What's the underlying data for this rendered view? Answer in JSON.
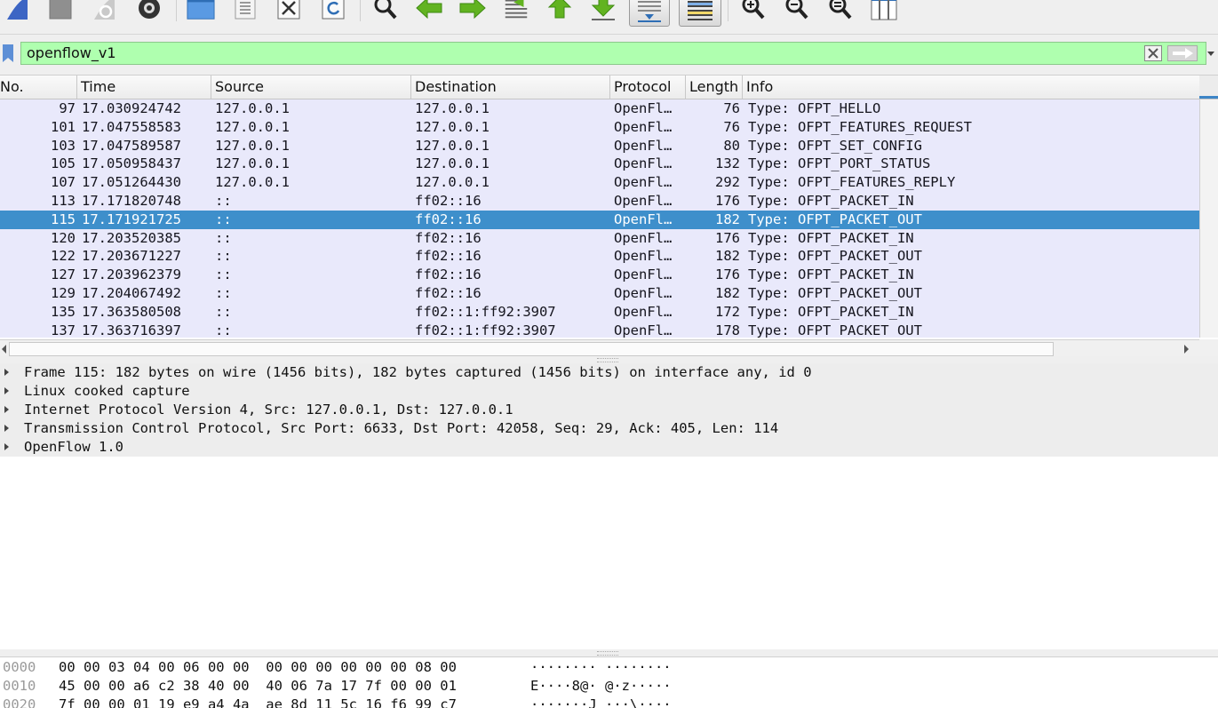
{
  "filter": {
    "value": "openflow_v1"
  },
  "packet_list": {
    "columns": [
      "No.",
      "Time",
      "Source",
      "Destination",
      "Protocol",
      "Length",
      "Info"
    ],
    "rows": [
      {
        "no": "97",
        "time": "17.030924742",
        "source": "127.0.0.1",
        "destination": "127.0.0.1",
        "protocol": "OpenFl…",
        "length": "76",
        "info": "Type: OFPT_HELLO"
      },
      {
        "no": "101",
        "time": "17.047558583",
        "source": "127.0.0.1",
        "destination": "127.0.0.1",
        "protocol": "OpenFl…",
        "length": "76",
        "info": "Type: OFPT_FEATURES_REQUEST"
      },
      {
        "no": "103",
        "time": "17.047589587",
        "source": "127.0.0.1",
        "destination": "127.0.0.1",
        "protocol": "OpenFl…",
        "length": "80",
        "info": "Type: OFPT_SET_CONFIG"
      },
      {
        "no": "105",
        "time": "17.050958437",
        "source": "127.0.0.1",
        "destination": "127.0.0.1",
        "protocol": "OpenFl…",
        "length": "132",
        "info": "Type: OFPT_PORT_STATUS"
      },
      {
        "no": "107",
        "time": "17.051264430",
        "source": "127.0.0.1",
        "destination": "127.0.0.1",
        "protocol": "OpenFl…",
        "length": "292",
        "info": "Type: OFPT_FEATURES_REPLY"
      },
      {
        "no": "113",
        "time": "17.171820748",
        "source": "::",
        "destination": "ff02::16",
        "protocol": "OpenFl…",
        "length": "176",
        "info": "Type: OFPT_PACKET_IN"
      },
      {
        "no": "115",
        "time": "17.171921725",
        "source": "::",
        "destination": "ff02::16",
        "protocol": "OpenFl…",
        "length": "182",
        "info": "Type: OFPT_PACKET_OUT"
      },
      {
        "no": "120",
        "time": "17.203520385",
        "source": "::",
        "destination": "ff02::16",
        "protocol": "OpenFl…",
        "length": "176",
        "info": "Type: OFPT_PACKET_IN"
      },
      {
        "no": "122",
        "time": "17.203671227",
        "source": "::",
        "destination": "ff02::16",
        "protocol": "OpenFl…",
        "length": "182",
        "info": "Type: OFPT_PACKET_OUT"
      },
      {
        "no": "127",
        "time": "17.203962379",
        "source": "::",
        "destination": "ff02::16",
        "protocol": "OpenFl…",
        "length": "176",
        "info": "Type: OFPT_PACKET_IN"
      },
      {
        "no": "129",
        "time": "17.204067492",
        "source": "::",
        "destination": "ff02::16",
        "protocol": "OpenFl…",
        "length": "182",
        "info": "Type: OFPT_PACKET_OUT"
      },
      {
        "no": "135",
        "time": "17.363580508",
        "source": "::",
        "destination": "ff02::1:ff92:3907",
        "protocol": "OpenFl…",
        "length": "172",
        "info": "Type: OFPT_PACKET_IN"
      },
      {
        "no": "137",
        "time": "17.363716397",
        "source": "::",
        "destination": "ff02::1:ff92:3907",
        "protocol": "OpenFl…",
        "length": "178",
        "info": "Type: OFPT_PACKET_OUT"
      }
    ],
    "selected_row": "115"
  },
  "details": [
    "Frame 115: 182 bytes on wire (1456 bits), 182 bytes captured (1456 bits) on interface any, id 0",
    "Linux cooked capture",
    "Internet Protocol Version 4, Src: 127.0.0.1, Dst: 127.0.0.1",
    "Transmission Control Protocol, Src Port: 6633, Dst Port: 42058, Seq: 29, Ack: 405, Len: 114",
    "OpenFlow 1.0"
  ],
  "bytes": [
    {
      "offset": "0000",
      "hex": "00 00 03 04 00 06 00 00  00 00 00 00 00 00 08 00",
      "ascii": "········ ········"
    },
    {
      "offset": "0010",
      "hex": "45 00 00 a6 c2 38 40 00  40 06 7a 17 7f 00 00 01",
      "ascii": "E····8@· @·z·····"
    },
    {
      "offset": "0020",
      "hex": "7f 00 00 01 19 e9 a4 4a  ae 8d 11 5c 16 f6 99 c7",
      "ascii": "·······J ···\\····"
    }
  ],
  "toolbar_icons": [
    "start-capture-icon",
    "stop-capture-icon",
    "restart-capture-icon",
    "capture-options-icon",
    "open-file-icon",
    "file-properties-icon",
    "close-file-icon",
    "reload-file-icon",
    "find-packet-icon",
    "go-back-icon",
    "go-forward-icon",
    "go-to-packet-icon",
    "first-packet-icon",
    "last-packet-icon",
    "autoscroll-icon",
    "colorize-icon",
    "zoom-in-icon",
    "zoom-out-icon",
    "normal-size-icon",
    "resize-columns-icon"
  ],
  "colors": {
    "row_bg": "#e9e9fb",
    "selected_row": "#3e8fcb",
    "filter_bg": "#afffaf"
  }
}
